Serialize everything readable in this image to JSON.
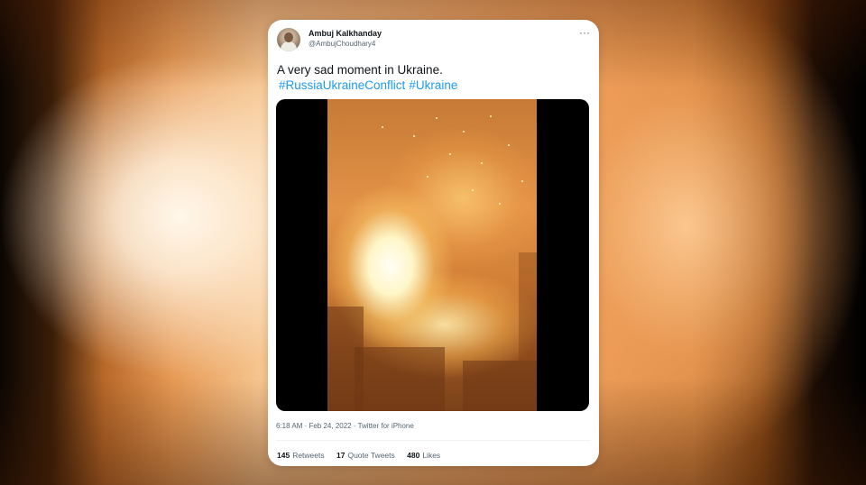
{
  "tweet": {
    "author_name": "Ambuj Kalkhanday",
    "author_handle": "@AmbujChoudhary4",
    "text": "A very sad moment in Ukraine.",
    "hashtags": [
      "#RussiaUkraineConflict",
      "#Ukraine"
    ],
    "timestamp": "6:18 AM · Feb 24, 2022 · Twitter for iPhone",
    "stats": {
      "retweets_count": "145",
      "retweets_label": "Retweets",
      "quotes_count": "17",
      "quotes_label": "Quote Tweets",
      "likes_count": "480",
      "likes_label": "Likes"
    },
    "more_icon": "more-horizontal-icon"
  },
  "colors": {
    "link": "#1d9bf0",
    "text": "#0f1419",
    "secondary": "#536471"
  }
}
